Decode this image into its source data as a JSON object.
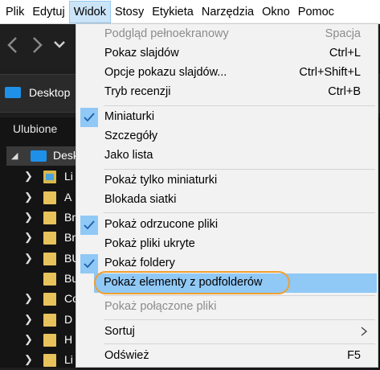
{
  "menubar": {
    "items": [
      "Plik",
      "Edytuj",
      "Widok",
      "Stosy",
      "Etykieta",
      "Narzędzia",
      "Okno",
      "Pomoc"
    ]
  },
  "pathbar": {
    "label": "Desktop"
  },
  "panel": {
    "title": "Ulubione",
    "root_label": "Desk",
    "rows": [
      "Li",
      "A",
      "Br",
      "Br",
      "BU",
      "Bu",
      "Co",
      "D",
      "H",
      "Li"
    ]
  },
  "menu": {
    "fullscreen": {
      "label": "Podgląd pełnoekranowy",
      "shortcut": "Spacja"
    },
    "slideshow": {
      "label": "Pokaz slajdów",
      "shortcut": "Ctrl+L"
    },
    "slideshow_options": {
      "label": "Opcje pokazu slajdów...",
      "shortcut": "Ctrl+Shift+L"
    },
    "review_mode": {
      "label": "Tryb recenzji",
      "shortcut": "Ctrl+B"
    },
    "thumbnails": {
      "label": "Miniaturki"
    },
    "details": {
      "label": "Szczegóły"
    },
    "as_list": {
      "label": "Jako lista"
    },
    "only_thumbnails": {
      "label": "Pokaż tylko miniaturki"
    },
    "grid_lock": {
      "label": "Blokada siatki"
    },
    "show_rejected": {
      "label": "Pokaż odrzucone pliki"
    },
    "show_hidden": {
      "label": "Pokaż pliki ukryte"
    },
    "show_folders": {
      "label": "Pokaż foldery"
    },
    "show_subfolders": {
      "label": "Pokaż elementy z podfolderów"
    },
    "show_linked": {
      "label": "Pokaż połączone pliki"
    },
    "sort": {
      "label": "Sortuj"
    },
    "refresh": {
      "label": "Odśwież",
      "shortcut": "F5"
    }
  },
  "colors": {
    "menu_highlight": "#90c8f6",
    "focus_ring": "#f0a030",
    "active_menubar": "#cce4f7"
  }
}
